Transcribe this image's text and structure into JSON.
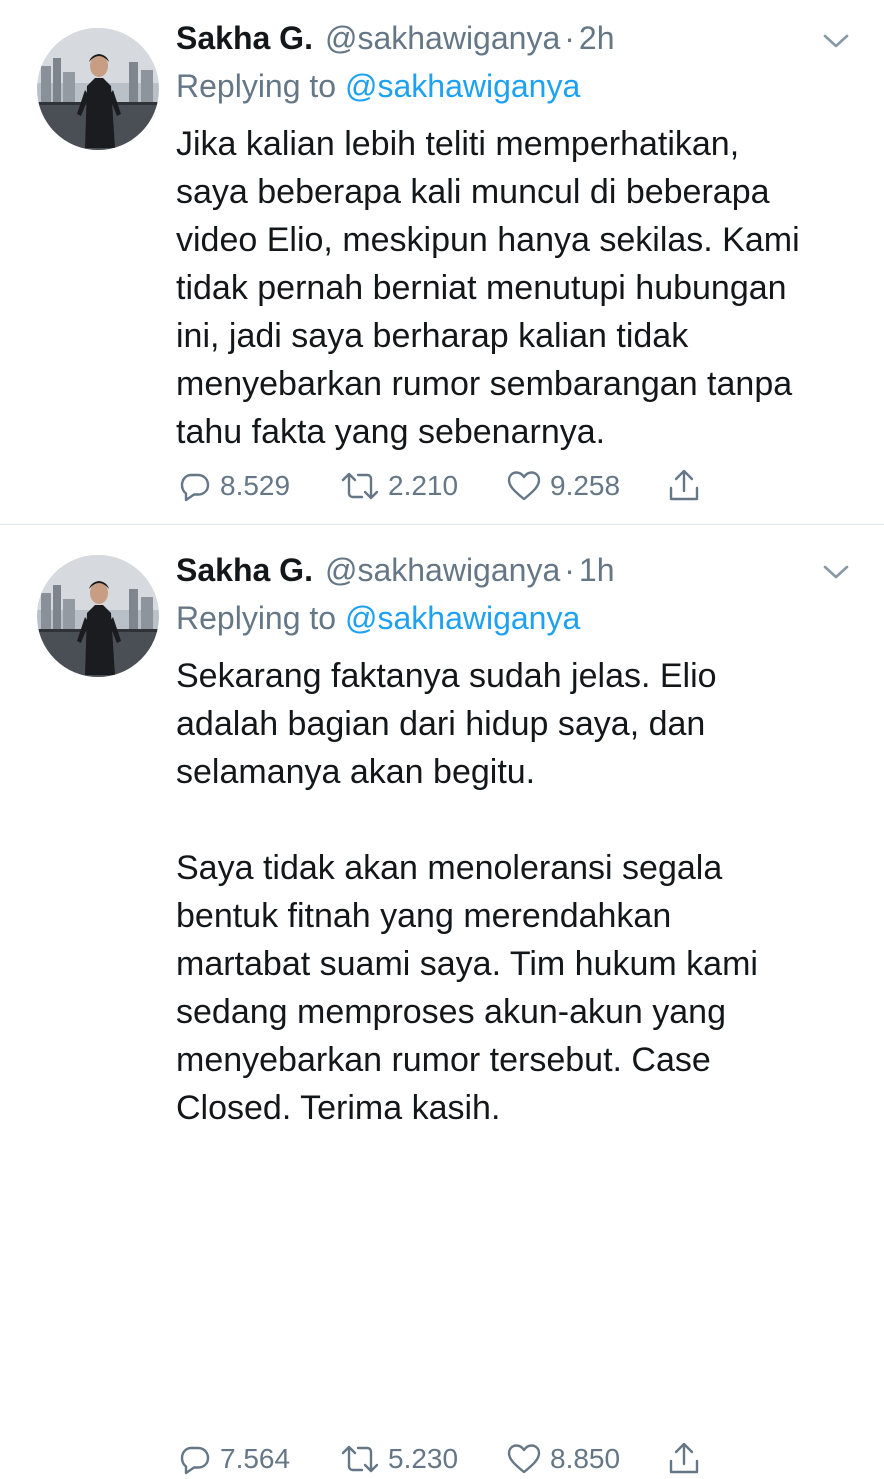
{
  "colors": {
    "text": "#14171a",
    "secondary": "#657786",
    "link": "#1da1f2",
    "divider": "#e1e8ed"
  },
  "tweets": [
    {
      "display_name": "Sakha G.",
      "handle": "@sakhawiganya",
      "separator": "·",
      "time": "2h",
      "replying_prefix": "Replying to",
      "replying_to": "@sakhawiganya",
      "lines": [
        "Jika kalian lebih teliti memperhatikan,",
        "saya beberapa kali muncul di beberapa",
        "video Elio, meskipun hanya sekilas. Kami",
        "tidak pernah berniat menutupi hubungan",
        "ini, jadi saya berharap kalian tidak",
        "menyebarkan rumor sembarangan tanpa",
        "tahu fakta yang sebenarnya."
      ],
      "replies": "8.529",
      "retweets": "2.210",
      "likes": "9.258",
      "icons": [
        "reply-icon",
        "retweet-icon",
        "like-icon",
        "share-icon",
        "chevron-down-icon"
      ]
    },
    {
      "display_name": "Sakha G.",
      "handle": "@sakhawiganya",
      "separator": "·",
      "time": "1h",
      "replying_prefix": "Replying to",
      "replying_to": "@sakhawiganya",
      "lines": [
        "Sekarang faktanya sudah jelas. Elio",
        "adalah bagian dari hidup saya, dan",
        "selamanya akan begitu.",
        "",
        "Saya tidak akan menoleransi segala",
        "bentuk fitnah yang merendahkan",
        "martabat suami saya. Tim hukum kami",
        "sedang memproses akun-akun yang",
        "menyebarkan rumor tersebut. Case",
        "Closed. Terima kasih."
      ],
      "replies": "7.564",
      "retweets": "5.230",
      "likes": "8.850",
      "icons": [
        "reply-icon",
        "retweet-icon",
        "like-icon",
        "share-icon",
        "chevron-down-icon"
      ]
    }
  ]
}
